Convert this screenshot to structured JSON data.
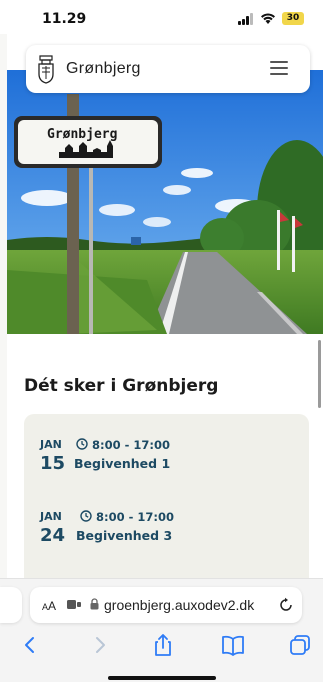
{
  "status_bar": {
    "time": "11.29",
    "battery": "30"
  },
  "header": {
    "site_name": "Grønbjerg",
    "logo_icon": "coat-of-arms-icon",
    "menu_icon": "hamburger-menu-icon"
  },
  "hero": {
    "sign_text": "Grønbjerg"
  },
  "section": {
    "title": "Dét sker i Grønbjerg"
  },
  "events": [
    {
      "month": "JAN",
      "day": "15",
      "time": "8:00 - 17:00",
      "title": "Begivenhed 1"
    },
    {
      "month": "JAN",
      "day": "24",
      "time": "8:00 - 17:00",
      "title": "Begivenhed 3"
    }
  ],
  "browser": {
    "aa_label": "AA",
    "url": "groenbjerg.auxodev2.dk",
    "toolbar_icons": [
      "back-icon",
      "forward-icon",
      "share-icon",
      "bookmarks-icon",
      "tabs-icon"
    ]
  },
  "colors": {
    "event_text": "#1d4a63",
    "events_card_bg": "#f0f0ea",
    "browser_accent": "#2f7cf6"
  }
}
